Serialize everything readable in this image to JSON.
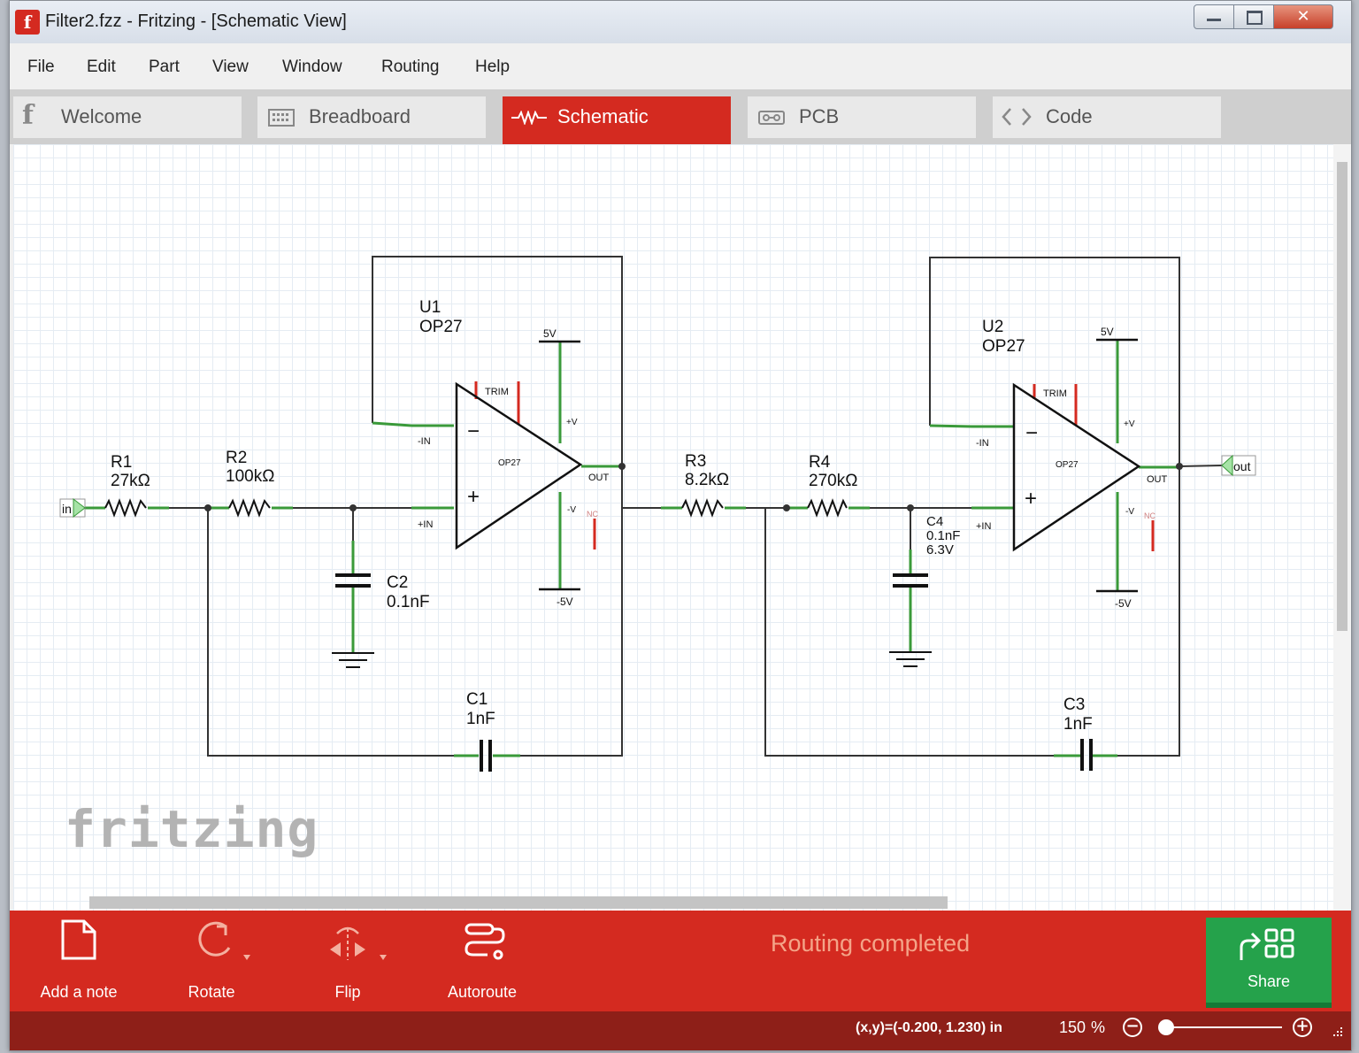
{
  "window": {
    "title": "Filter2.fzz - Fritzing - [Schematic View]",
    "app_icon": "f",
    "close_glyph": "✕"
  },
  "menu": [
    "File",
    "Edit",
    "Part",
    "View",
    "Window",
    "Routing",
    "Help"
  ],
  "tabs": [
    {
      "label": "Welcome",
      "icon": "fritzing-f-icon",
      "active": false
    },
    {
      "label": "Breadboard",
      "icon": "breadboard-icon",
      "active": false
    },
    {
      "label": "Schematic",
      "icon": "schematic-icon",
      "active": true
    },
    {
      "label": "PCB",
      "icon": "pcb-icon",
      "active": false
    },
    {
      "label": "Code",
      "icon": "code-icon",
      "active": false
    }
  ],
  "schematic": {
    "input_port": "in",
    "output_port": "out",
    "parts": {
      "r1": {
        "name": "R1",
        "value": "27kΩ"
      },
      "r2": {
        "name": "R2",
        "value": "100kΩ"
      },
      "r3": {
        "name": "R3",
        "value": "8.2kΩ"
      },
      "r4": {
        "name": "R4",
        "value": "270kΩ"
      },
      "c1": {
        "name": "C1",
        "value": "1nF"
      },
      "c2": {
        "name": "C2",
        "value": "0.1nF"
      },
      "c3": {
        "name": "C3",
        "value": "1nF"
      },
      "c4": {
        "name": "C4",
        "value": "0.1nF",
        "voltage": "6.3V"
      },
      "u1": {
        "name": "U1",
        "value": "OP27"
      },
      "u2": {
        "name": "U2",
        "value": "OP27"
      }
    },
    "opamp_labels": {
      "body": "OP27",
      "trim": "TRIM",
      "plus_v": "+V",
      "minus_v": "-V",
      "out": "OUT",
      "in_minus": "-IN",
      "in_plus": "+IN",
      "nc": "NC",
      "minus_sign": "−",
      "plus_sign": "+"
    },
    "supply": {
      "pos": "5V",
      "neg": "-5V"
    },
    "watermark": "fritzing"
  },
  "toolbar": {
    "buttons": [
      {
        "label": "Add a note",
        "icon": "note-icon"
      },
      {
        "label": "Rotate",
        "icon": "rotate-icon"
      },
      {
        "label": "Flip",
        "icon": "flip-icon"
      },
      {
        "label": "Autoroute",
        "icon": "autoroute-icon"
      }
    ],
    "status": "Routing completed",
    "share": {
      "label": "Share",
      "icon": "share-icon"
    }
  },
  "statusbar": {
    "coords": "(x,y)=(-0.200, 1.230) in",
    "zoom_value": "150",
    "zoom_unit": "%",
    "zoom_out": "−",
    "zoom_in": "+"
  },
  "colors": {
    "accent": "#d42a20",
    "share": "#25a24b",
    "footer": "#8e1f18",
    "wire_green": "#3a9a3a",
    "wire_dark": "#333333"
  }
}
